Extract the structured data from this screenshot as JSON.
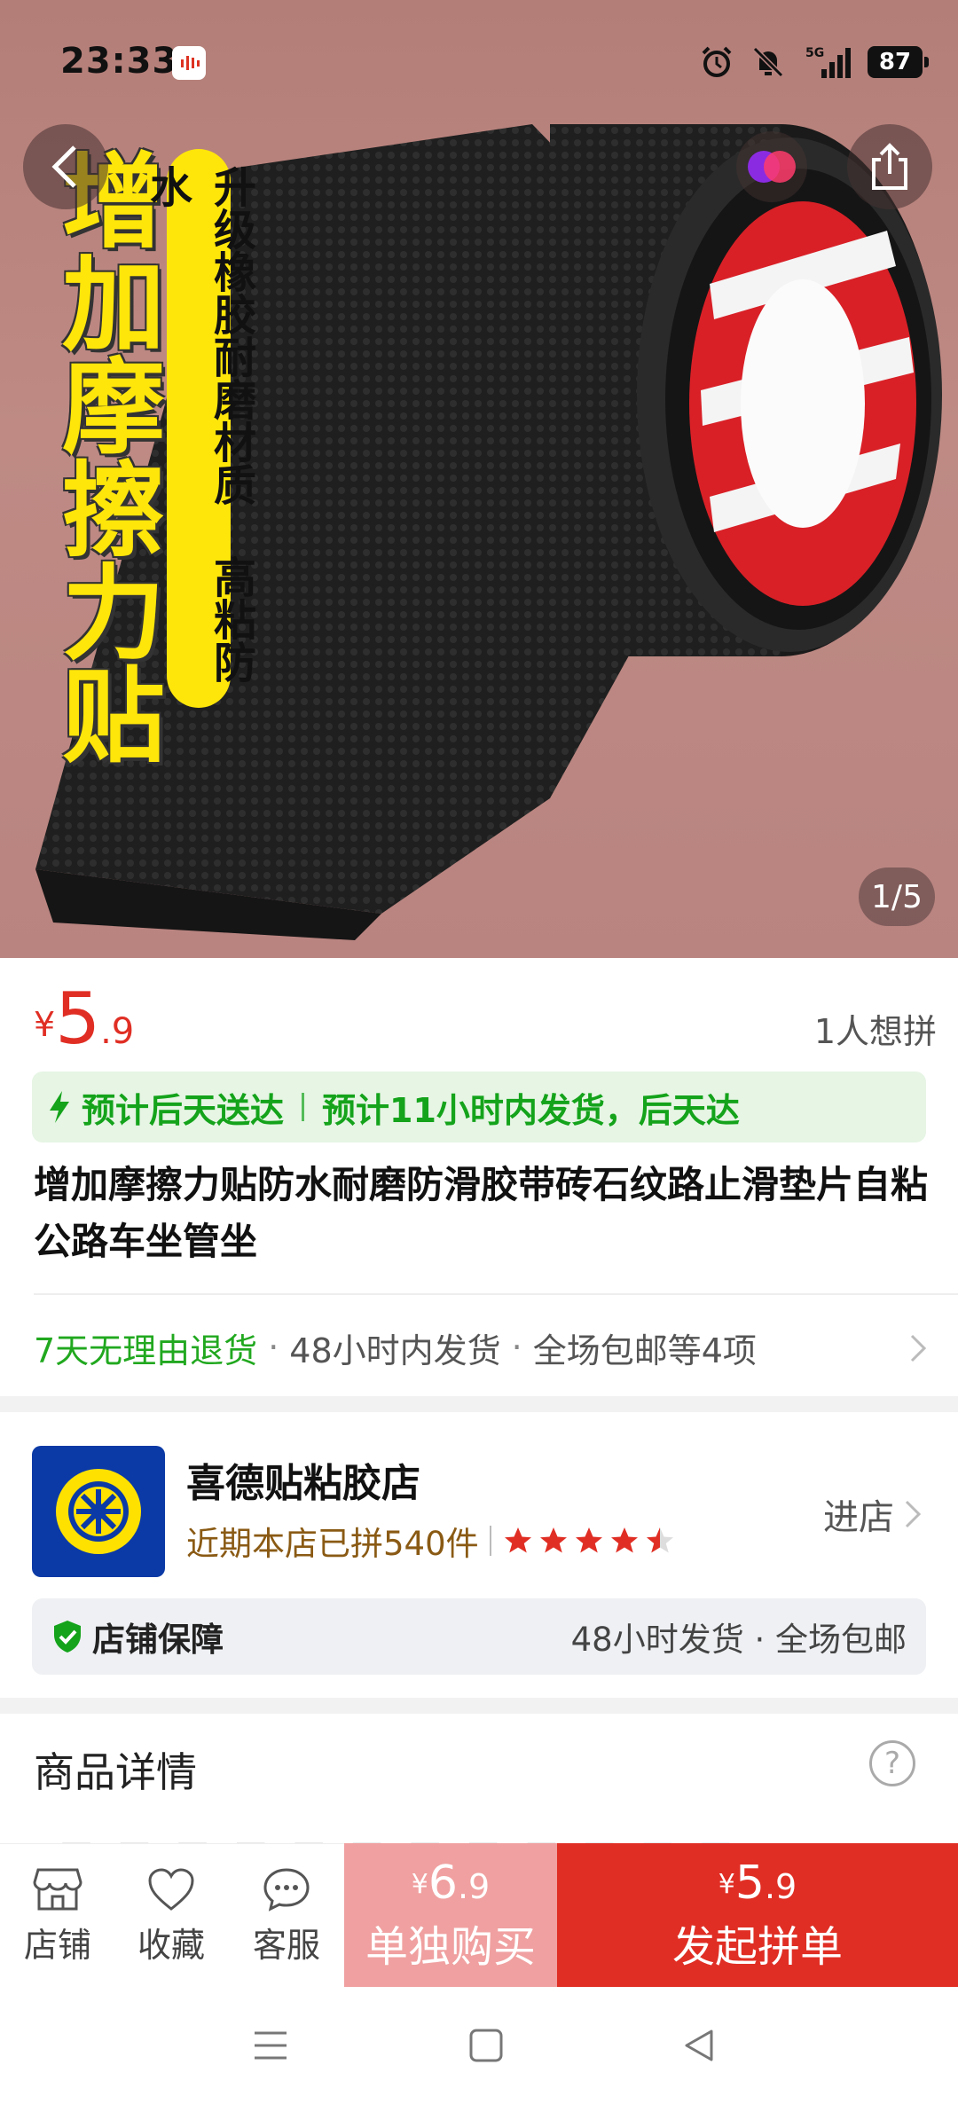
{
  "status_bar": {
    "time": "23:33",
    "network": "5G",
    "battery": "87"
  },
  "hero": {
    "headline": "增加摩擦力贴",
    "badge_text": "升级橡胶耐磨材质 高粘防水",
    "image_counter": "1/5",
    "bg_color": "#b98480",
    "accent_yellow": "#ffe60a"
  },
  "price": {
    "symbol": "¥",
    "integer": "5",
    "decimal": ".9",
    "want_count": "1人想拼",
    "color": "#e02e24"
  },
  "delivery": {
    "primary": "预计后天送达",
    "secondary": "预计11小时内发货，后天达",
    "color": "#14a31b"
  },
  "product_title": "增加摩擦力贴防水耐磨防滑胶带砖石纹路止滑垫片自粘公路车坐管坐",
  "services": {
    "return_policy": "7天无理由退货",
    "ship_time": "48小时内发货",
    "more": "全场包邮等4项"
  },
  "shop": {
    "name": "喜德贴粘胶店",
    "sales": "近期本店已拼540件",
    "rating": 4.5,
    "enter_label": "进店",
    "guarantee_title": "店铺保障",
    "guarantee_items": "48小时发货 · 全场包邮"
  },
  "details": {
    "title": "商品详情"
  },
  "bottom_bar": {
    "shop_label": "店铺",
    "fav_label": "收藏",
    "service_label": "客服",
    "solo": {
      "symbol": "¥",
      "integer": "6",
      "decimal": ".9",
      "label": "单独购买"
    },
    "group": {
      "symbol": "¥",
      "integer": "5",
      "decimal": ".9",
      "label": "发起拼单"
    }
  }
}
